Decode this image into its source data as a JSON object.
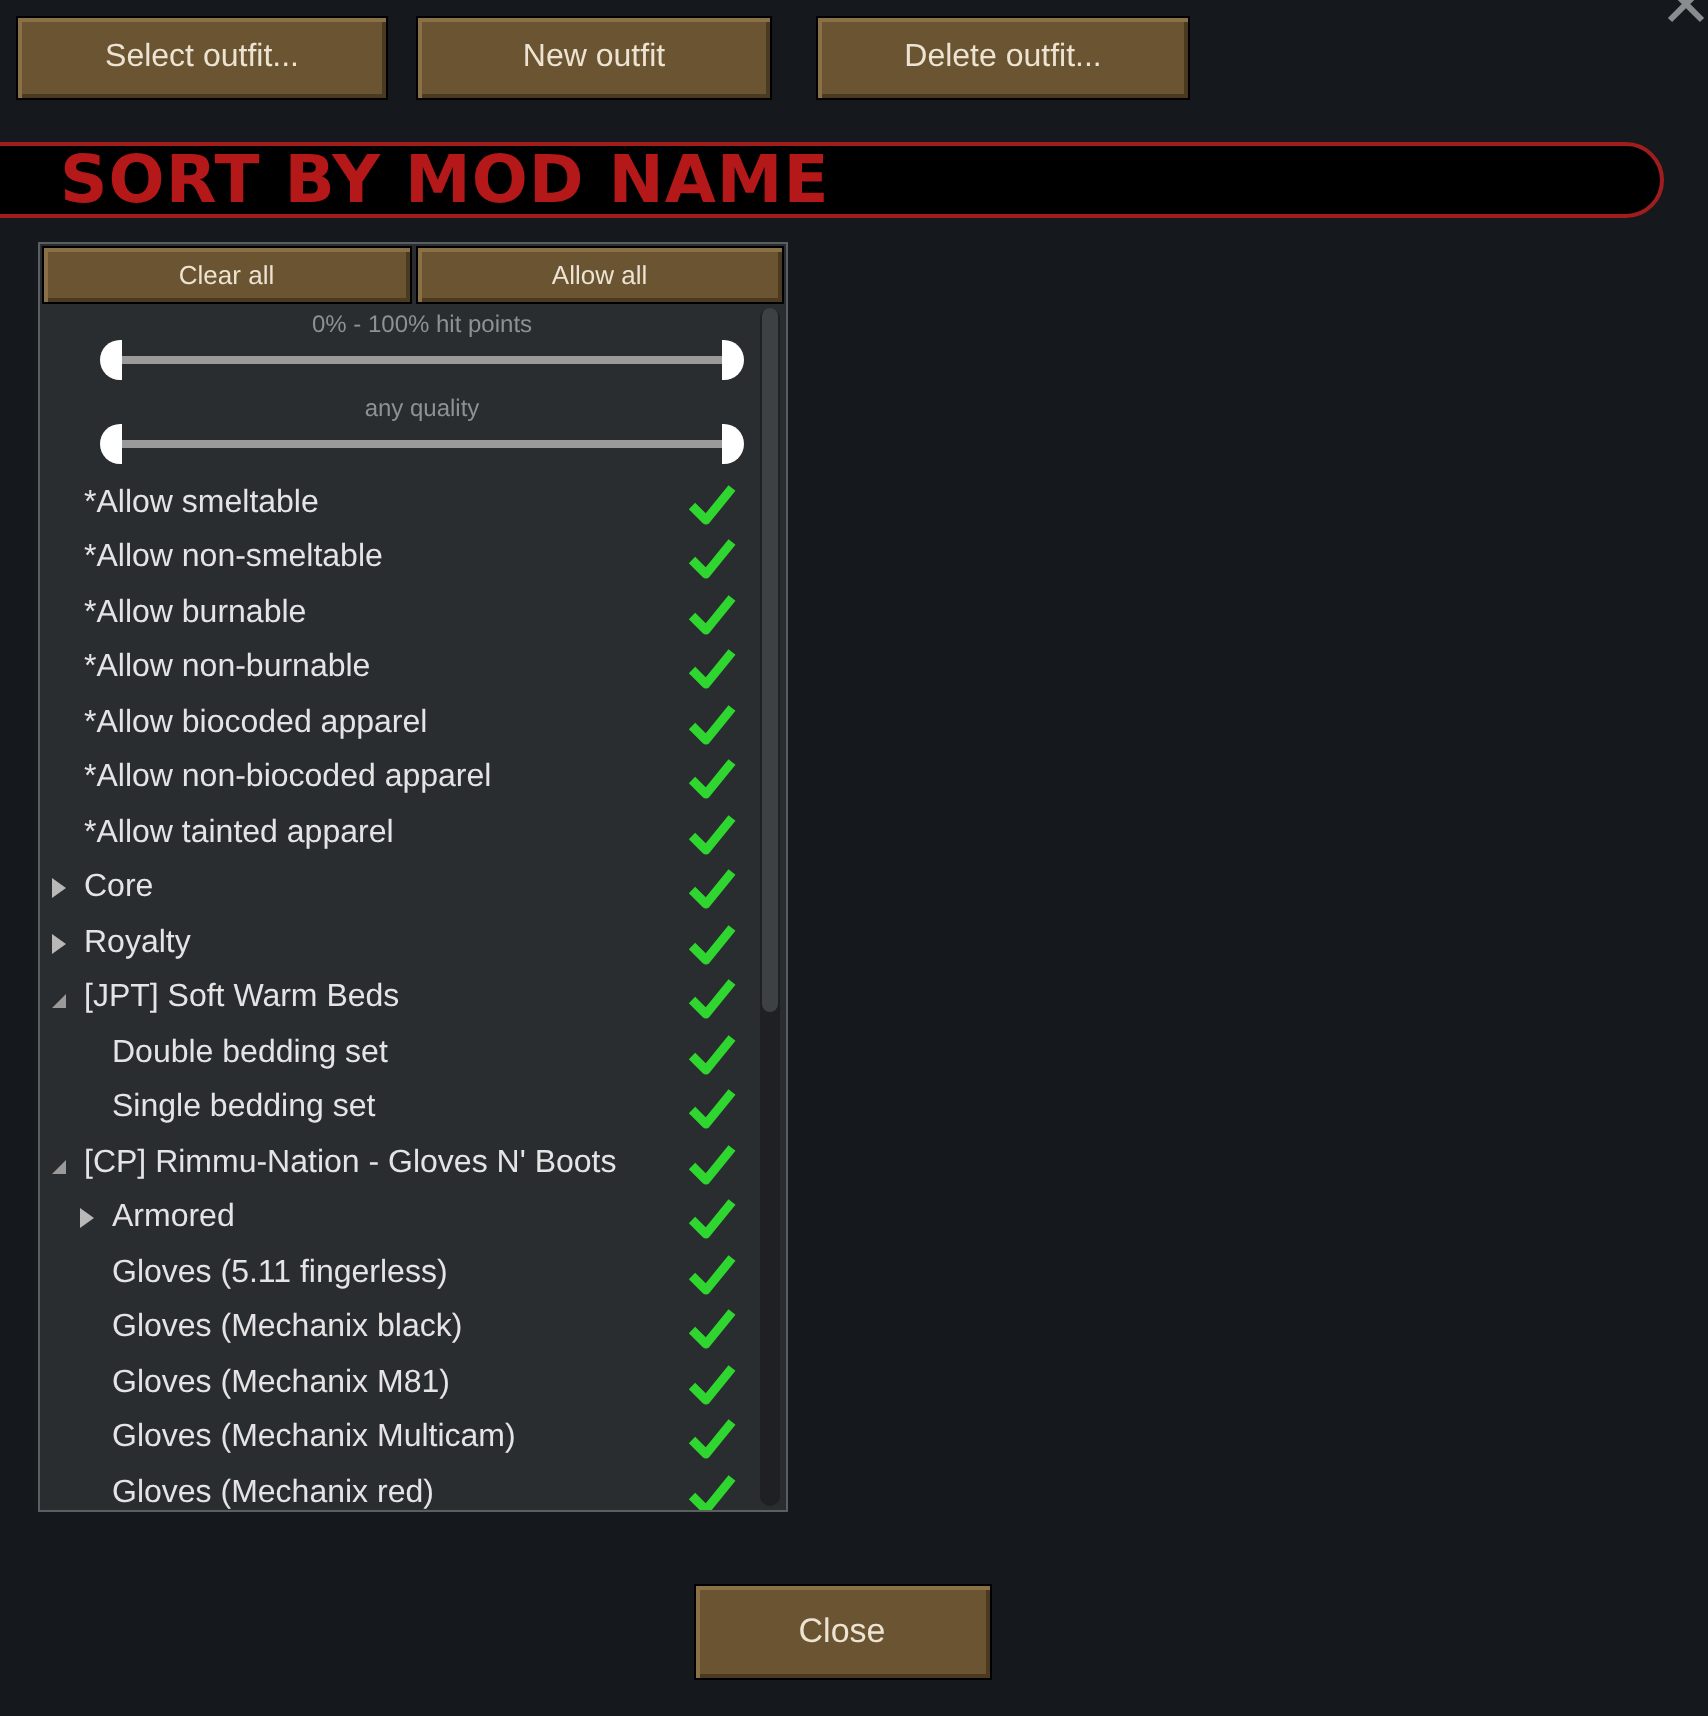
{
  "toolbar": {
    "buttons": [
      "Select outfit...",
      "New outfit",
      "Delete outfit..."
    ]
  },
  "banner": {
    "title": "SORT BY MOD NAME"
  },
  "filter": {
    "buttons": [
      "Clear all",
      "Allow all"
    ],
    "sliders": [
      {
        "label": "0% - 100% hit points",
        "handles": [
          {
            "level": 0
          },
          {
            "level": 1
          }
        ]
      },
      {
        "label": "any quality",
        "handles": [
          {
            "level": 0
          },
          {
            "level": 1
          }
        ]
      }
    ],
    "items": [
      {
        "label": "*Allow smeltable",
        "checked": true
      },
      {
        "label": "*Allow non-smeltable",
        "checked": true
      },
      {
        "label": "*Allow burnable",
        "checked": true
      },
      {
        "label": "*Allow non-burnable",
        "checked": true
      },
      {
        "label": "*Allow biocoded apparel",
        "checked": true
      },
      {
        "label": "*Allow non-biocoded apparel",
        "checked": true
      },
      {
        "label": "*Allow tainted apparel",
        "checked": true
      },
      {
        "label": "Core",
        "checked": true,
        "expanded": false
      },
      {
        "label": "Royalty",
        "checked": true,
        "expanded": false
      },
      {
        "label": "[JPT] Soft Warm Beds",
        "checked": true,
        "expanded": true,
        "children": [
          {
            "label": "Double bedding set",
            "checked": true
          },
          {
            "label": "Single bedding set",
            "checked": true
          }
        ]
      },
      {
        "label": "[CP] Rimmu-Nation - Gloves N' Boots",
        "checked": true,
        "expanded": true,
        "children": [
          {
            "label": "Armored",
            "checked": true,
            "expanded": false
          },
          {
            "label": "Gloves (5.11 fingerless)",
            "checked": true
          },
          {
            "label": "Gloves (Mechanix black)",
            "checked": true
          },
          {
            "label": "Gloves (Mechanix M81)",
            "checked": true
          },
          {
            "label": "Gloves (Mechanix Multicam)",
            "checked": true
          },
          {
            "label": "Gloves (Mechanix red)",
            "checked": true
          }
        ]
      }
    ]
  },
  "footer": {
    "button": "Close"
  }
}
